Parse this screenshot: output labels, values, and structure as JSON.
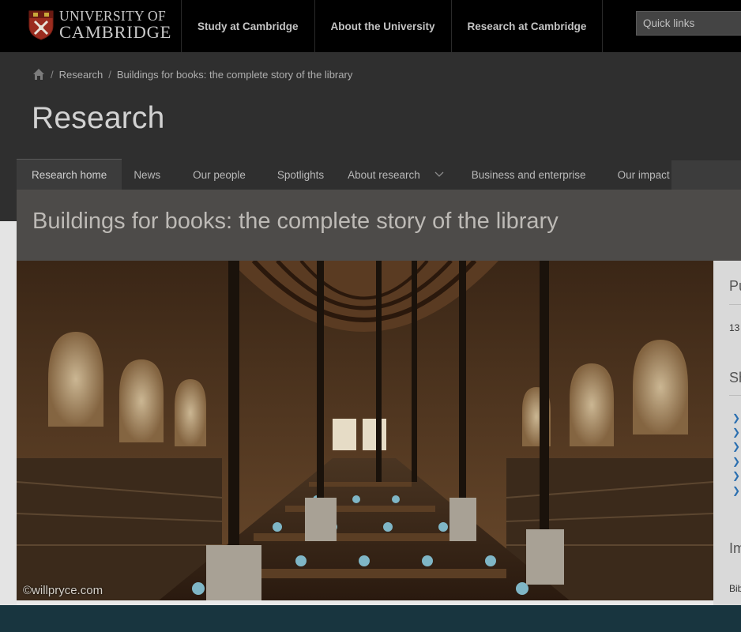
{
  "header": {
    "logo_line1": "UNIVERSITY OF",
    "logo_line2": "CAMBRIDGE",
    "nav": [
      "Study at Cambridge",
      "About the University",
      "Research at Cambridge"
    ],
    "quick_links": "Quick links"
  },
  "breadcrumb": {
    "items": [
      "Research",
      "Buildings for books: the complete story of the library"
    ],
    "separator": "/"
  },
  "section": {
    "title": "Research",
    "subnav": [
      "Research home",
      "News",
      "Our people",
      "Spotlights",
      "About research",
      "Business and enterprise",
      "Our impact"
    ]
  },
  "article": {
    "title": "Buildings for books: the complete story of the library",
    "image_credit": "©willpryce.com"
  },
  "sidebar": {
    "heading1": "Pu",
    "date_fragment": "13",
    "heading2": "Sh",
    "heading3": "Im",
    "footer_fragment": "Bib"
  },
  "colors": {
    "topbar": "#000000",
    "section_bg": "#2f2f2f",
    "title_band": "#4d4b49",
    "footer_band": "#18353f",
    "link_arrow": "#2b6fb0"
  }
}
